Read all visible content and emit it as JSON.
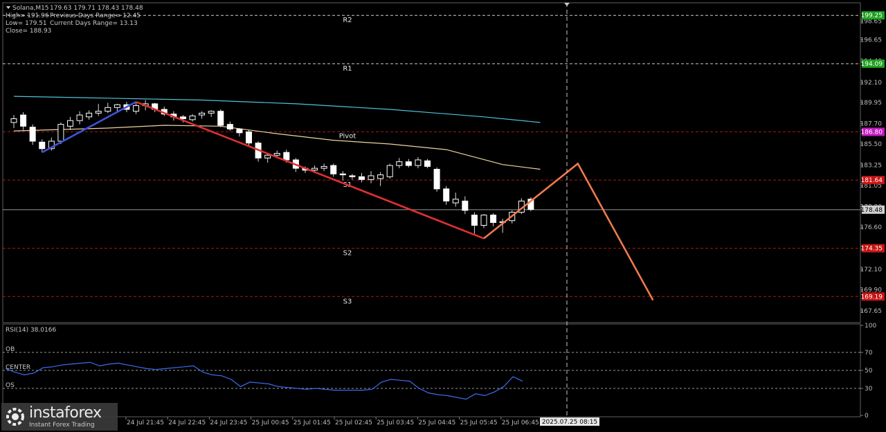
{
  "header": {
    "symbol": "Solana,M15",
    "ohlc": "179.63 179.71 178.43 178.48",
    "high": "High= 191.96",
    "prev_range": "Previous Days Range= 12.45",
    "low": "Low= 179.51",
    "curr_range": "Current Days Range= 13.13",
    "close": "Close= 188.93"
  },
  "price_axis": {
    "min": 166.4,
    "max": 200.6,
    "ticks": [
      "198.65",
      "196.65",
      "194.40",
      "192.10",
      "189.95",
      "187.70",
      "185.50",
      "183.25",
      "181.05",
      "178.80",
      "176.60",
      "174.35",
      "172.10",
      "169.90",
      "167.65"
    ]
  },
  "levels": [
    {
      "name": "R2",
      "label": "R2",
      "price": 199.25,
      "badge": "199.25",
      "color": "#1fa01f",
      "style": "dash-white"
    },
    {
      "name": "R1",
      "label": "R1",
      "price": 194.09,
      "badge": "194.09",
      "color": "#1fa01f",
      "style": "dash-white"
    },
    {
      "name": "Pivot",
      "label": "Pivot",
      "price": 186.8,
      "badge": "186.80",
      "color": "#c21bc2",
      "style": "dash-red"
    },
    {
      "name": "S1",
      "label": "S1",
      "price": 181.64,
      "badge": "181.64",
      "color": "#c81414",
      "style": "dash-red"
    },
    {
      "name": "S2",
      "label": "S2",
      "price": 174.35,
      "badge": "174.35",
      "color": "#c81414",
      "style": "dash-red"
    },
    {
      "name": "S3",
      "label": "S3",
      "price": 169.19,
      "badge": "169.19",
      "color": "#c81414",
      "style": "dash-red"
    }
  ],
  "current_price": {
    "price": 178.48,
    "badge": "178.48",
    "color": "#d0d0d0"
  },
  "time_axis": {
    "labels": [
      "24 Jul 21:45",
      "24 Jul 22:45",
      "24 Jul 23:45",
      "25 Jul 00:45",
      "25 Jul 01:45",
      "25 Jul 02:45",
      "25 Jul 03:45",
      "25 Jul 04:45",
      "25 Jul 05:45",
      "25 Jul 06:45"
    ],
    "current": "2025.07.25 08:15"
  },
  "chart_data": {
    "type": "candlestick",
    "candles": [
      {
        "o": 187.8,
        "h": 188.6,
        "l": 187.2,
        "c": 188.2
      },
      {
        "o": 188.6,
        "h": 188.9,
        "l": 187.0,
        "c": 187.4
      },
      {
        "o": 187.3,
        "h": 187.6,
        "l": 185.4,
        "c": 185.8
      },
      {
        "o": 185.7,
        "h": 186.0,
        "l": 184.6,
        "c": 185.0
      },
      {
        "o": 185.0,
        "h": 186.2,
        "l": 184.8,
        "c": 185.8
      },
      {
        "o": 185.8,
        "h": 187.8,
        "l": 185.5,
        "c": 187.6
      },
      {
        "o": 187.4,
        "h": 188.4,
        "l": 187.0,
        "c": 188.0
      },
      {
        "o": 188.0,
        "h": 189.0,
        "l": 187.6,
        "c": 188.6
      },
      {
        "o": 188.4,
        "h": 189.1,
        "l": 188.1,
        "c": 188.8
      },
      {
        "o": 188.8,
        "h": 189.8,
        "l": 188.5,
        "c": 189.0
      },
      {
        "o": 189.0,
        "h": 189.9,
        "l": 188.8,
        "c": 189.4
      },
      {
        "o": 189.4,
        "h": 189.8,
        "l": 189.0,
        "c": 189.7
      },
      {
        "o": 189.7,
        "h": 190.0,
        "l": 188.9,
        "c": 189.2
      },
      {
        "o": 189.0,
        "h": 189.9,
        "l": 188.7,
        "c": 189.6
      },
      {
        "o": 189.6,
        "h": 190.2,
        "l": 189.1,
        "c": 189.8
      },
      {
        "o": 189.8,
        "h": 189.9,
        "l": 188.9,
        "c": 189.2
      },
      {
        "o": 189.2,
        "h": 189.5,
        "l": 188.5,
        "c": 188.7
      },
      {
        "o": 188.7,
        "h": 189.0,
        "l": 188.0,
        "c": 188.4
      },
      {
        "o": 188.4,
        "h": 188.6,
        "l": 187.8,
        "c": 188.2
      },
      {
        "o": 188.1,
        "h": 188.7,
        "l": 187.9,
        "c": 188.5
      },
      {
        "o": 188.6,
        "h": 189.0,
        "l": 188.2,
        "c": 188.8
      },
      {
        "o": 188.8,
        "h": 189.1,
        "l": 188.4,
        "c": 189.0
      },
      {
        "o": 189.0,
        "h": 189.2,
        "l": 187.3,
        "c": 187.5
      },
      {
        "o": 187.6,
        "h": 187.9,
        "l": 186.9,
        "c": 187.1
      },
      {
        "o": 187.1,
        "h": 187.2,
        "l": 186.3,
        "c": 186.7
      },
      {
        "o": 186.8,
        "h": 187.0,
        "l": 185.2,
        "c": 185.6
      },
      {
        "o": 185.6,
        "h": 185.8,
        "l": 183.6,
        "c": 184.0
      },
      {
        "o": 184.0,
        "h": 184.5,
        "l": 183.5,
        "c": 184.3
      },
      {
        "o": 184.3,
        "h": 184.8,
        "l": 184.0,
        "c": 184.5
      },
      {
        "o": 184.6,
        "h": 184.9,
        "l": 183.5,
        "c": 183.8
      },
      {
        "o": 183.8,
        "h": 184.0,
        "l": 182.5,
        "c": 182.9
      },
      {
        "o": 182.9,
        "h": 183.1,
        "l": 182.4,
        "c": 182.7
      },
      {
        "o": 182.7,
        "h": 183.2,
        "l": 182.5,
        "c": 182.9
      },
      {
        "o": 182.9,
        "h": 183.4,
        "l": 182.6,
        "c": 183.1
      },
      {
        "o": 183.2,
        "h": 183.4,
        "l": 182.0,
        "c": 182.3
      },
      {
        "o": 182.3,
        "h": 182.6,
        "l": 181.6,
        "c": 182.2
      },
      {
        "o": 182.1,
        "h": 182.3,
        "l": 181.7,
        "c": 182.0
      },
      {
        "o": 182.0,
        "h": 182.4,
        "l": 181.4,
        "c": 181.7
      },
      {
        "o": 181.7,
        "h": 182.6,
        "l": 181.3,
        "c": 182.1
      },
      {
        "o": 181.8,
        "h": 182.5,
        "l": 181.0,
        "c": 182.2
      },
      {
        "o": 182.0,
        "h": 183.4,
        "l": 181.8,
        "c": 183.2
      },
      {
        "o": 183.2,
        "h": 184.0,
        "l": 182.9,
        "c": 183.6
      },
      {
        "o": 183.6,
        "h": 183.9,
        "l": 183.0,
        "c": 183.2
      },
      {
        "o": 183.2,
        "h": 184.1,
        "l": 182.9,
        "c": 183.8
      },
      {
        "o": 183.7,
        "h": 183.9,
        "l": 182.9,
        "c": 183.1
      },
      {
        "o": 182.8,
        "h": 183.0,
        "l": 180.4,
        "c": 180.7
      },
      {
        "o": 180.7,
        "h": 181.0,
        "l": 179.0,
        "c": 179.4
      },
      {
        "o": 179.2,
        "h": 180.3,
        "l": 178.8,
        "c": 179.6
      },
      {
        "o": 179.4,
        "h": 179.9,
        "l": 178.0,
        "c": 178.4
      },
      {
        "o": 177.9,
        "h": 178.2,
        "l": 175.9,
        "c": 176.8
      },
      {
        "o": 176.8,
        "h": 178.0,
        "l": 176.5,
        "c": 177.9
      },
      {
        "o": 177.9,
        "h": 178.1,
        "l": 176.7,
        "c": 177.1
      },
      {
        "o": 177.1,
        "h": 177.5,
        "l": 176.0,
        "c": 177.2
      },
      {
        "o": 177.3,
        "h": 178.4,
        "l": 177.0,
        "c": 178.2
      },
      {
        "o": 178.2,
        "h": 179.7,
        "l": 178.0,
        "c": 179.4
      },
      {
        "o": 179.6,
        "h": 179.8,
        "l": 178.3,
        "c": 178.5
      }
    ],
    "moving_averages": [
      {
        "color": "#4fc3d9",
        "points": [
          [
            0,
            190.6
          ],
          [
            10,
            190.4
          ],
          [
            20,
            190.2
          ],
          [
            30,
            189.8
          ],
          [
            40,
            189.2
          ],
          [
            50,
            188.4
          ],
          [
            56,
            187.8
          ]
        ]
      },
      {
        "color": "#e8d8a0",
        "points": [
          [
            0,
            186.9
          ],
          [
            10,
            187.2
          ],
          [
            16,
            187.5
          ],
          [
            22,
            187.4
          ],
          [
            28,
            186.6
          ],
          [
            34,
            185.9
          ],
          [
            40,
            185.5
          ],
          [
            46,
            184.9
          ],
          [
            52,
            183.3
          ],
          [
            56,
            182.8
          ]
        ]
      }
    ],
    "trend_lines": [
      {
        "color": "#3b55d9",
        "from": [
          3,
          184.6
        ],
        "to": [
          13,
          190.0
        ]
      },
      {
        "color": "#e03030",
        "from": [
          13,
          190.0
        ],
        "to": [
          50,
          175.4
        ]
      }
    ],
    "forecast": {
      "color": "#f07a4c",
      "points": [
        [
          50,
          175.4
        ],
        [
          60,
          183.4
        ],
        [
          68,
          168.8
        ]
      ]
    },
    "rsi": {
      "label": "RSI(14) 38.0166",
      "ylim": [
        0,
        100
      ],
      "levels": [
        {
          "value": 70,
          "label": "OB"
        },
        {
          "value": 50,
          "label": "CENTER"
        },
        {
          "value": 30,
          "label": "OS"
        }
      ],
      "ticks": [
        "100",
        "70",
        "50",
        "30",
        "0"
      ],
      "values": [
        52,
        48,
        45,
        47,
        53,
        54,
        56,
        57,
        58,
        59,
        55,
        57,
        58,
        56,
        54,
        52,
        51,
        52,
        53,
        54,
        55,
        48,
        45,
        44,
        40,
        32,
        37,
        36,
        35,
        32,
        31,
        30,
        29,
        30,
        29,
        28,
        28,
        28,
        28,
        29,
        37,
        40,
        39,
        38,
        30,
        25,
        23,
        22,
        20,
        18,
        24,
        22,
        26,
        32,
        43,
        38
      ]
    }
  }
}
